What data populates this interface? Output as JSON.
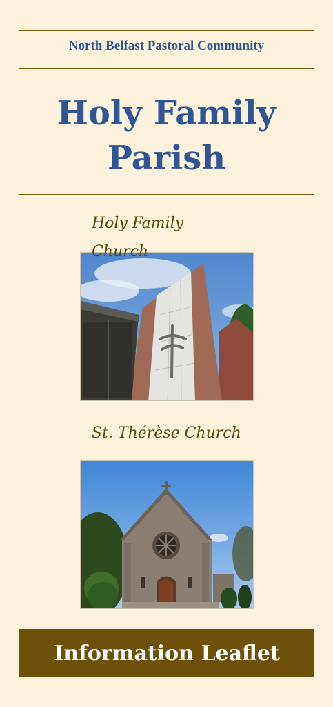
{
  "header": {
    "community": "North Belfast Pastoral Community",
    "title_line1": "Holy Family",
    "title_line2": "Parish"
  },
  "churches": [
    {
      "caption_line1": "Holy Family",
      "caption_line2": "Church"
    },
    {
      "caption": "St. Thérèse Church"
    }
  ],
  "footer": {
    "banner": "Information Leaflet"
  },
  "colors": {
    "background": "#fdf3dd",
    "title_blue": "#2f5597",
    "rule_brown": "#7a5a10",
    "banner_brown": "#6e5109",
    "caption_brown": "#5e4608"
  }
}
